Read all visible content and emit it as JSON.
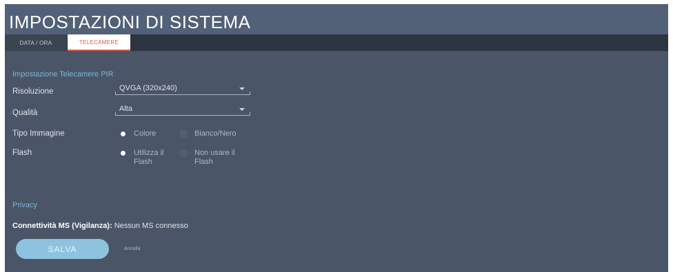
{
  "header": {
    "title": "IMPOSTAZIONI DI SISTEMA"
  },
  "tabs": [
    {
      "label": "DATA / ORA",
      "active": false
    },
    {
      "label": "TELECAMERE",
      "active": true
    }
  ],
  "pir_section": {
    "title": "Impostazione Telecamere PIR",
    "resolution": {
      "label": "Risoluzione",
      "value": "QVGA (320x240)"
    },
    "quality": {
      "label": "Qualità",
      "value": "Alta"
    },
    "image_type": {
      "label": "Tipo Immagine",
      "options": [
        {
          "label": "Colore",
          "selected": true
        },
        {
          "label": "Bianco/Nero",
          "selected": false
        }
      ]
    },
    "flash": {
      "label": "Flash",
      "options": [
        {
          "label": "Utilizza il Flash",
          "selected": true
        },
        {
          "label": "Non usare il Flash",
          "selected": false
        }
      ]
    }
  },
  "privacy": {
    "title": "Privacy",
    "connectivity_label": "Connettività MS (Vigilanza):",
    "connectivity_value": "Nessun MS connesso"
  },
  "actions": {
    "save_label": "SALVA",
    "cancel_label": "Annulla"
  },
  "colors": {
    "accent_tab": "#e0574a",
    "section_title": "#7fb6d6",
    "save_button": "#8ec3e0",
    "background": "#4a5568"
  }
}
